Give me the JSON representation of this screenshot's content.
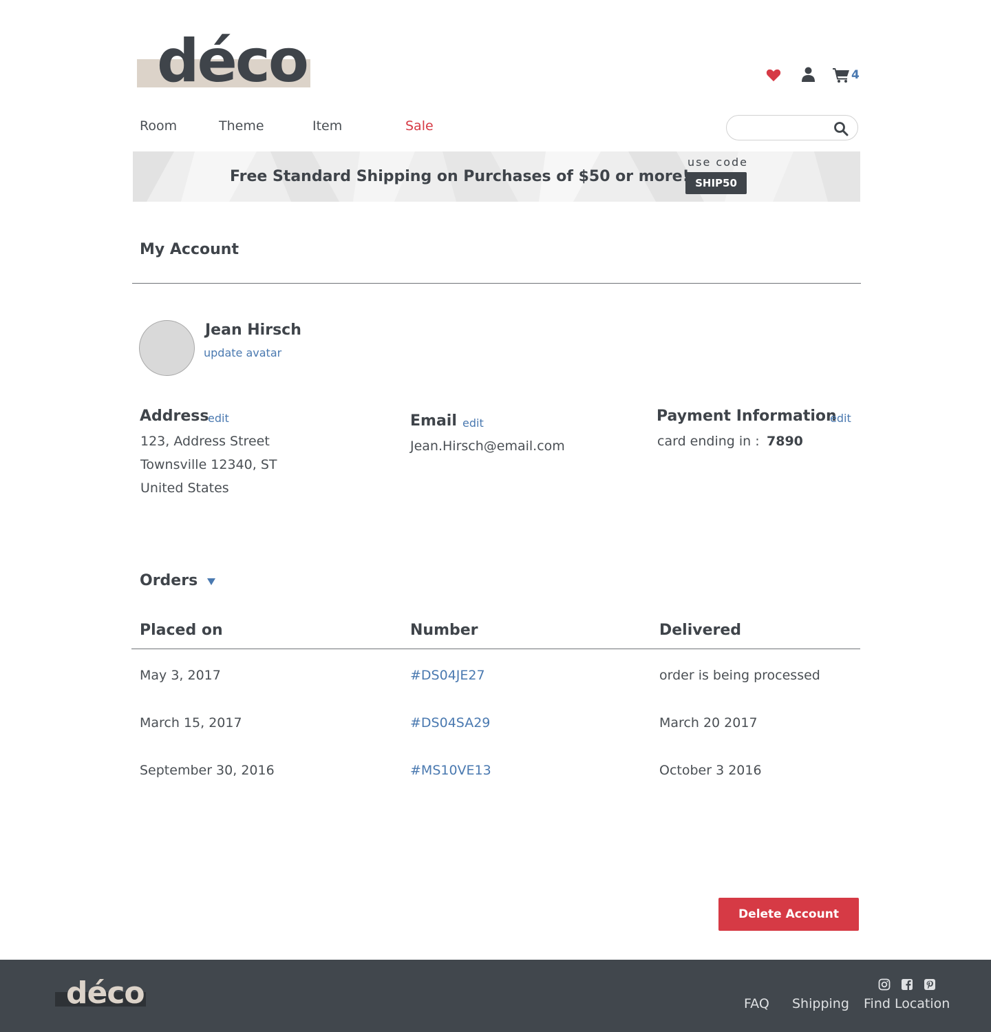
{
  "brand": {
    "logo_text": "déco"
  },
  "header": {
    "cart_count": "4"
  },
  "nav": {
    "items": [
      {
        "label": "Room"
      },
      {
        "label": "Theme"
      },
      {
        "label": "Item"
      },
      {
        "label": "Sale"
      }
    ],
    "search_placeholder": ""
  },
  "banner": {
    "message": "Free Standard Shipping on Purchases of $50 or more!",
    "use_code_label": "use code",
    "code": "SHIP50"
  },
  "account": {
    "title": "My Account",
    "user_name": "Jean Hirsch",
    "update_avatar": "update avatar",
    "address": {
      "heading": "Address",
      "edit": "edit",
      "lines": [
        "123, Address Street",
        "Townsville 12340, ST",
        "United States"
      ]
    },
    "email": {
      "heading": "Email",
      "edit": "edit",
      "value": "Jean.Hirsch@email.com"
    },
    "payment": {
      "heading": "Payment Information",
      "edit": "edit",
      "label": "card ending in :",
      "last4": "7890"
    }
  },
  "orders": {
    "title": "Orders",
    "columns": [
      "Placed on",
      "Number",
      "Delivered"
    ],
    "rows": [
      {
        "placed": "May 3, 2017",
        "number": "#DS04JE27",
        "delivered": "order is being processed"
      },
      {
        "placed": "March 15, 2017",
        "number": "#DS04SA29",
        "delivered": "March 20 2017"
      },
      {
        "placed": "September 30, 2016",
        "number": "#MS10VE13",
        "delivered": "October 3 2016"
      }
    ]
  },
  "actions": {
    "delete_account": "Delete Account"
  },
  "footer": {
    "logo_text": "déco",
    "social_icons": [
      "instagram-icon",
      "facebook-icon",
      "pinterest-icon"
    ],
    "links": [
      "FAQ",
      "Shipping",
      "Find Location"
    ]
  },
  "colors": {
    "accent_red": "#d63a45",
    "link_blue": "#4a79b0",
    "text_dark": "#3f444a",
    "logo_bar": "#dcd3c9",
    "footer_bg": "#41474d"
  }
}
